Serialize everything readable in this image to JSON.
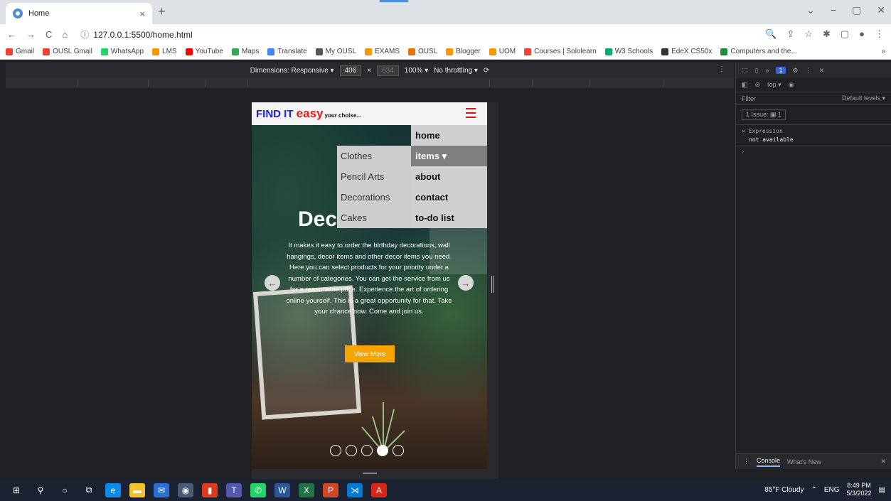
{
  "browser": {
    "tab_title": "Home",
    "tab_close": "×",
    "new_tab": "+",
    "url": "127.0.0.1:5500/home.html",
    "window_controls": [
      "⌄",
      "−",
      "▢",
      "✕"
    ],
    "nav": {
      "back": "←",
      "forward": "→",
      "reload": "C",
      "home": "⌂",
      "info": "ⓘ"
    },
    "toolbar_icons": [
      "🔍",
      "⇪",
      "☆",
      "✱",
      "▢",
      "●",
      "⋮"
    ]
  },
  "bookmarks": [
    {
      "label": "Gmail",
      "color": "#ea4335"
    },
    {
      "label": "OUSL Gmail",
      "color": "#ea4335"
    },
    {
      "label": "WhatsApp",
      "color": "#25d366"
    },
    {
      "label": "LMS",
      "color": "#f29900"
    },
    {
      "label": "YouTube",
      "color": "#ff0000"
    },
    {
      "label": "Maps",
      "color": "#34a853"
    },
    {
      "label": "Translate",
      "color": "#4285f4"
    },
    {
      "label": "My OUSL",
      "color": "#555555"
    },
    {
      "label": "EXAMS",
      "color": "#f29900"
    },
    {
      "label": "OUSL",
      "color": "#e37400"
    },
    {
      "label": "Blogger",
      "color": "#ff9800"
    },
    {
      "label": "UOM",
      "color": "#f29900"
    },
    {
      "label": "Courses | Sololearn",
      "color": "#f44336"
    },
    {
      "label": "W3 Schools",
      "color": "#04aa6d"
    },
    {
      "label": "EdeX CS50x",
      "color": "#333333"
    },
    {
      "label": "Computers and the...",
      "color": "#1e8e3e"
    }
  ],
  "bookmarks_more": "»",
  "device_toolbar": {
    "dimensions_label": "Dimensions: Responsive ▾",
    "width": "406",
    "times": "×",
    "height": "634",
    "zoom": "100% ▾",
    "throttling": "No throttling ▾",
    "rotate": "⟳",
    "more": "⋮"
  },
  "site": {
    "logo_main": "FIND IT ",
    "logo_easy": "easy",
    "logo_tag": "your choise...",
    "menu": [
      {
        "label": "home",
        "active": false
      },
      {
        "label": "items ▾",
        "active": true
      },
      {
        "label": "about",
        "active": false
      },
      {
        "label": "contact",
        "active": false
      },
      {
        "label": "to-do list",
        "active": false
      }
    ],
    "submenu": [
      "Clothes",
      "Pencil Arts",
      "Decorations",
      "Cakes"
    ],
    "hero_title": "Decorations",
    "hero_text": "It makes it easy to order the birthday decorations, wall hangings, decor items and other decor items you need. Here you can select products for your priority under a number of categories. You can get the service from us for a reasonable price. Experience the art of ordering online yourself. This is a great opportunity for that. Take your chance now. Come and join us.",
    "view_more": "View More",
    "arrow_left": "←",
    "arrow_right": "→",
    "carousel_active_index": 3,
    "carousel_count": 5
  },
  "devtools": {
    "top_badge": "1",
    "context": "top ▾",
    "filter_placeholder": "Filter",
    "levels": "Default levels ▾",
    "issues": "1 Issue: ▣ 1",
    "expression_label": "× Expression",
    "expression_value": "not available",
    "prompt": "›",
    "bottom_tabs": [
      "Console",
      "What's New"
    ],
    "close": "✕"
  },
  "taskbar": {
    "weather": "85°F Cloudy",
    "lang": "ENG",
    "time": "8:49 PM",
    "date": "5/3/2022"
  }
}
